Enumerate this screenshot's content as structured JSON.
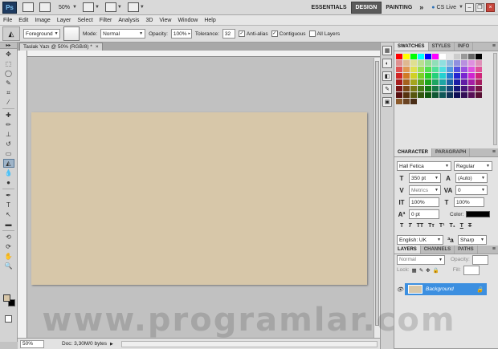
{
  "app": {
    "logo": "Ps",
    "zoom": "50%",
    "workspaces": [
      "ESSENTIALS",
      "DESIGN",
      "PAINTING"
    ],
    "active_workspace": "DESIGN",
    "more": "»",
    "cs_live": "CS Live"
  },
  "menu": [
    "File",
    "Edit",
    "Image",
    "Layer",
    "Select",
    "Filter",
    "Analysis",
    "3D",
    "View",
    "Window",
    "Help"
  ],
  "options": {
    "fill_source": "Foreground",
    "mode_label": "Mode:",
    "mode_value": "Normal",
    "opacity_label": "Opacity:",
    "opacity_value": "100%",
    "tolerance_label": "Tolerance:",
    "tolerance_value": "32",
    "anti_alias_label": "Anti-alias",
    "contiguous_label": "Contiguous",
    "all_layers_label": "All Layers",
    "anti_alias": true,
    "contiguous": true,
    "all_layers": false
  },
  "document": {
    "tab_title": "Taslak Yazı @ 50% (RGB/8) *",
    "close": "×",
    "canvas_color": "#d7c7a9"
  },
  "status": {
    "zoom": "50%",
    "doc_info": "Doc: 3,30M/0 bytes"
  },
  "colors": {
    "foreground": "#d7c6a8",
    "background": "#000000"
  },
  "panels": {
    "swatches_tabs": [
      "SWATCHES",
      "STYLES",
      "INFO"
    ],
    "character_tabs": [
      "CHARACTER",
      "PARAGRAPH"
    ],
    "layers_tabs": [
      "LAYERS",
      "CHANNELS",
      "PATHS"
    ]
  },
  "character": {
    "font_family": "Hall Fetica",
    "font_style": "Regular",
    "font_size": "350 pt",
    "leading": "(Auto)",
    "kerning": "Metrics",
    "tracking": "0",
    "vertical_scale": "100%",
    "horizontal_scale": "100%",
    "baseline_shift": "0 pt",
    "color_label": "Color:",
    "text_color": "#000000",
    "language": "English: UK",
    "anti_alias": "Sharp"
  },
  "layers": {
    "blend_mode": "Normal",
    "opacity_label": "Opacity:",
    "lock_label": "Lock:",
    "fill_label": "Fill:",
    "items": [
      {
        "name": "Background",
        "selected": true
      }
    ]
  },
  "watermark": "www.programlar.com"
}
